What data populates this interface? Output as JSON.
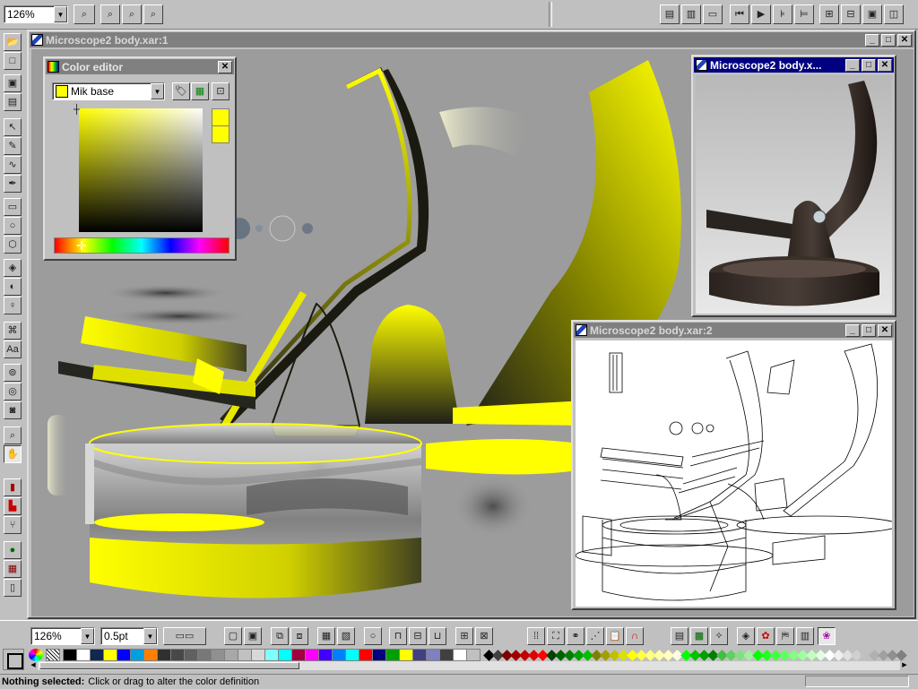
{
  "top_toolbar": {
    "zoom_value": "126%"
  },
  "main_window": {
    "title": "Microscope2 body.xar:1"
  },
  "color_editor": {
    "title": "Color editor",
    "color_name": "Mik base",
    "color_hex": "#ffff00"
  },
  "window_b": {
    "title": "Microscope2 body.x..."
  },
  "window_c": {
    "title": "Microscope2 body.xar:2"
  },
  "bottom_toolbar": {
    "zoom_value": "126%",
    "line_width_value": "0.5pt"
  },
  "status_bar": {
    "bold_text": "Nothing selected:",
    "message": "Click or drag to alter the color definition"
  },
  "palette": {
    "colors": [
      "#000000",
      "#ffffff",
      "#102850",
      "#ffff00",
      "#0000ff",
      "#00a0e0",
      "#ff8000",
      "#303030",
      "#484848",
      "#606060",
      "#787878",
      "#909090",
      "#a8a8a8",
      "#c0c0c0",
      "#d8d8d8",
      "#80ffff",
      "#00ffff",
      "#a00040",
      "#ff00ff",
      "#4000ff",
      "#0080ff",
      "#00ffff",
      "#ff0000",
      "#000080",
      "#00a000",
      "#ffff00",
      "#404080",
      "#8080c0",
      "#404040",
      "#ffffff",
      "#c0c0c0"
    ],
    "diamonds": [
      "#000000",
      "#404040",
      "#800000",
      "#a00000",
      "#c00000",
      "#e00000",
      "#ff0000",
      "#004000",
      "#006000",
      "#008000",
      "#00a000",
      "#00c000",
      "#808000",
      "#a0a000",
      "#c0c000",
      "#e0e000",
      "#ffff00",
      "#ffff40",
      "#ffff80",
      "#ffffa0",
      "#ffffc0",
      "#ffffe0",
      "#00ff00",
      "#00c000",
      "#00a000",
      "#008000",
      "#40c040",
      "#60d060",
      "#80e080",
      "#a0f0a0",
      "#00ff00",
      "#20ff20",
      "#40ff40",
      "#60ff60",
      "#80ff80",
      "#a0ffa0",
      "#c0ffc0",
      "#e0ffe0",
      "#ffffff",
      "#f0f0f0",
      "#e0e0e0",
      "#d0d0d0",
      "#c0c0c0",
      "#b0b0b0",
      "#a0a0a0",
      "#909090",
      "#808080",
      "#707070"
    ]
  }
}
